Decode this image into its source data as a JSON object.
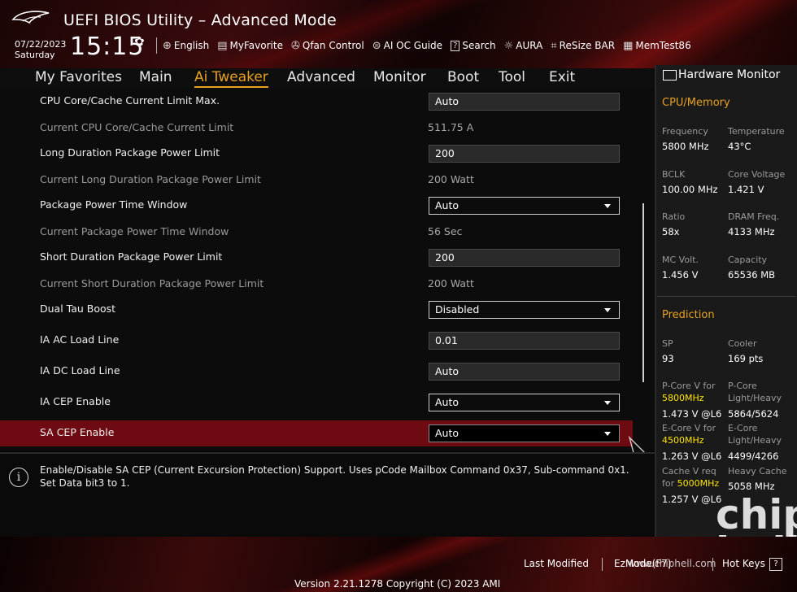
{
  "header": {
    "title": "UEFI BIOS Utility – Advanced Mode",
    "date": "07/22/2023",
    "weekday": "Saturday",
    "time": "15:15",
    "toolbar": [
      {
        "label": "English",
        "icon": "globe-icon"
      },
      {
        "label": "MyFavorite",
        "icon": "favorite-icon"
      },
      {
        "label": "Qfan Control",
        "icon": "fan-icon"
      },
      {
        "label": "AI OC Guide",
        "icon": "ai-icon"
      },
      {
        "label": "Search",
        "icon": "search-icon"
      },
      {
        "label": "AURA",
        "icon": "aura-icon"
      },
      {
        "label": "ReSize BAR",
        "icon": "resize-bar-icon"
      },
      {
        "label": "MemTest86",
        "icon": "memtest-icon"
      }
    ]
  },
  "nav": {
    "tabs": [
      "My Favorites",
      "Main",
      "Ai Tweaker",
      "Advanced",
      "Monitor",
      "Boot",
      "Tool",
      "Exit"
    ],
    "active": "Ai Tweaker"
  },
  "settings": [
    {
      "label": "CPU Core/Cache Current Limit Max.",
      "type": "field",
      "value": "Auto"
    },
    {
      "label": "Current CPU Core/Cache Current Limit",
      "type": "info",
      "value": "511.75 A"
    },
    {
      "label": "Long Duration Package Power Limit",
      "type": "field",
      "value": "200"
    },
    {
      "label": "Current Long Duration Package Power Limit",
      "type": "info",
      "value": "200 Watt"
    },
    {
      "label": "Package Power Time Window",
      "type": "select",
      "value": "Auto"
    },
    {
      "label": "Current Package Power Time Window",
      "type": "info",
      "value": "56 Sec"
    },
    {
      "label": "Short Duration Package Power Limit",
      "type": "field",
      "value": "200"
    },
    {
      "label": "Current Short Duration Package Power Limit",
      "type": "info",
      "value": "200 Watt"
    },
    {
      "label": "Dual Tau Boost",
      "type": "select",
      "value": "Disabled"
    },
    {
      "label": "IA AC Load Line",
      "type": "field",
      "value": "0.01"
    },
    {
      "label": "IA DC Load Line",
      "type": "field",
      "value": "Auto"
    },
    {
      "label": "IA CEP Enable",
      "type": "select",
      "value": "Auto"
    },
    {
      "label": "SA CEP Enable",
      "type": "select",
      "value": "Auto"
    }
  ],
  "help": {
    "text": "Enable/Disable SA CEP (Current Excursion Protection) Support. Uses pCode Mailbox Command 0x37, Sub-command 0x1. Set Data bit3 to 1."
  },
  "hwmon": {
    "title": "Hardware Monitor",
    "cpu_memory": {
      "heading": "CPU/Memory",
      "items": [
        {
          "label": "Frequency",
          "value": "5800 MHz"
        },
        {
          "label": "Temperature",
          "value": "43°C"
        },
        {
          "label": "BCLK",
          "value": "100.00 MHz"
        },
        {
          "label": "Core Voltage",
          "value": "1.421 V"
        },
        {
          "label": "Ratio",
          "value": "58x"
        },
        {
          "label": "DRAM Freq.",
          "value": "4133 MHz"
        },
        {
          "label": "MC Volt.",
          "value": "1.456 V"
        },
        {
          "label": "Capacity",
          "value": "65536 MB"
        }
      ]
    },
    "prediction": {
      "heading": "Prediction",
      "sp_label": "SP",
      "sp_value": "93",
      "cooler_label": "Cooler",
      "cooler_value": "169 pts",
      "pcore_label1": "P-Core V for",
      "pcore_freq": "5800MHz",
      "pcore_value": "1.473 V @L6",
      "pcore_lh_label1": "P-Core",
      "pcore_lh_label2": "Light/Heavy",
      "pcore_lh_value": "5864/5624",
      "ecore_label1": "E-Core V for",
      "ecore_freq": "4500MHz",
      "ecore_value": "1.263 V @L6",
      "ecore_lh_label1": "E-Core",
      "ecore_lh_label2": "Light/Heavy",
      "ecore_lh_value": "4499/4266",
      "cache_label1": "Cache V req",
      "cache_label2": "for",
      "cache_freq": "5000MHz",
      "cache_value": "1.257 V @L6",
      "heavy_cache_label": "Heavy Cache",
      "heavy_cache_value": "5058 MHz"
    }
  },
  "footer": {
    "last_modified": "Last Modified",
    "ezmode": "EzMode(F7)",
    "hotkeys": "Hot Keys",
    "version": "Version 2.21.1278 Copyright (C) 2023 AMI",
    "watermark_url": "www.chiphell.com",
    "watermark_logo": "chip hell"
  },
  "colors": {
    "accent": "#e8a020",
    "highlight_row": "#6e0a12",
    "prediction_freq": "#ffe400"
  }
}
